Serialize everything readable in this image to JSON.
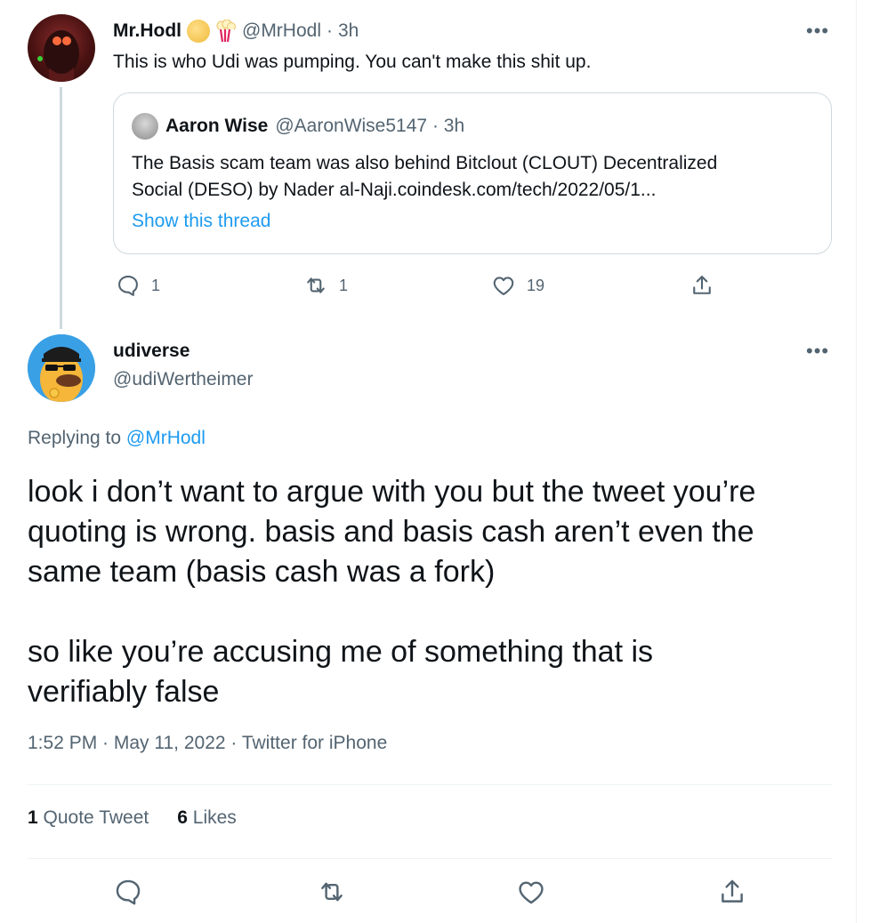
{
  "parent_tweet": {
    "display_name": "Mr.Hodl",
    "handle": "@MrHodl",
    "time": "3h",
    "dot": "·",
    "text": "This is who Udi was pumping. You can't make this shit up.",
    "more": "•••",
    "quoted": {
      "display_name": "Aaron Wise",
      "handle": "@AaronWise5147",
      "time": "3h",
      "text_line1": "The Basis scam team was also behind Bitclout (CLOUT) Decentralized",
      "text_line2": "Social (DESO) by Nader al-Naji.coindesk.com/tech/2022/05/1...",
      "show_thread": "Show this thread"
    },
    "counts": {
      "replies": "1",
      "retweets": "1",
      "likes": "19"
    }
  },
  "focal_tweet": {
    "display_name": "udiverse",
    "handle": "@udiWertheimer",
    "more": "•••",
    "replying_prefix": "Replying to",
    "replying_to": "@MrHodl",
    "body": {
      "p1_line1": "look i don’t want to argue with you but the tweet you’re",
      "p1_line2": "quoting is wrong. basis and basis cash aren’t even the",
      "p1_line3": "same team (basis cash was a fork)",
      "p2_line1": "so like you’re accusing me of something that is",
      "p2_line2": "verifiably false"
    },
    "timestamp": "1:52 PM · May 11, 2022 · Twitter for iPhone",
    "quote_tweets_count": "1",
    "quote_tweets_label": "Quote Tweet",
    "likes_count": "6",
    "likes_label": "Likes"
  },
  "icons": [
    "reply-icon",
    "retweet-icon",
    "like-icon",
    "share-icon",
    "more-icon"
  ],
  "colors": {
    "link": "#1d9bf0",
    "secondary_text": "#536471",
    "primary_text": "#0f1419",
    "border": "#cfd9de"
  }
}
